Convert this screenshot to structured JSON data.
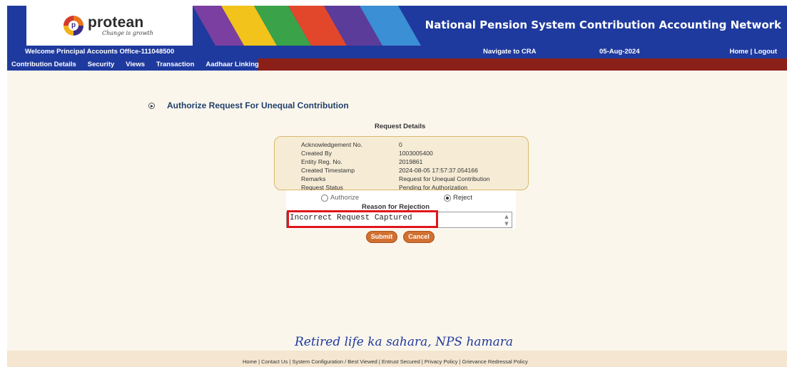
{
  "header": {
    "logo_name": "protean",
    "logo_tagline": "Change is growth",
    "title": "National Pension System Contribution Accounting Network",
    "stripe_colors": [
      "#7a3fa0",
      "#f2c31b",
      "#3aa34a",
      "#e2472b",
      "#5b3c9a",
      "#3b8fd4"
    ]
  },
  "welcome_bar": {
    "welcome": "Welcome Principal Accounts Office-111048500",
    "navigate": "Navigate to CRA",
    "date": "05-Aug-2024",
    "home": "Home",
    "separator": "|",
    "logout": "Logout"
  },
  "menu": {
    "items": [
      "Contribution Details",
      "Security",
      "Views",
      "Transaction",
      "Aadhaar Linking"
    ]
  },
  "page": {
    "title": "Authorize Request For Unequal Contribution",
    "request_details_heading": "Request Details"
  },
  "details": [
    {
      "label": "Acknowledgement No.",
      "value": "0"
    },
    {
      "label": "Created By",
      "value": "1003005400"
    },
    {
      "label": "Entity Reg. No.",
      "value": "2019861"
    },
    {
      "label": "Created Timestamp",
      "value": "2024-08-05 17:57:37.054166"
    },
    {
      "label": "Remarks",
      "value": "Request for Unequal Contribution"
    },
    {
      "label": "Request Status",
      "value": "Pending for Authorization"
    }
  ],
  "action": {
    "authorize_label": "Authorize",
    "reject_label": "Reject",
    "selected": "Reject",
    "reason_label": "Reason for Rejection",
    "reason_value": "Incorrect Request Captured"
  },
  "buttons": {
    "submit": "Submit",
    "cancel": "Cancel"
  },
  "slogan": "Retired life ka sahara, NPS hamara",
  "footer": {
    "links": "Home | Contact Us | System Configuration / Best Viewed | Entrust Secured | Privacy Policy | Grievance Redressal Policy"
  },
  "colors": {
    "nav_blue": "#1f3a9e",
    "menu_red": "#8b2019",
    "button_orange": "#d27030",
    "highlight_red": "#e0151b"
  }
}
